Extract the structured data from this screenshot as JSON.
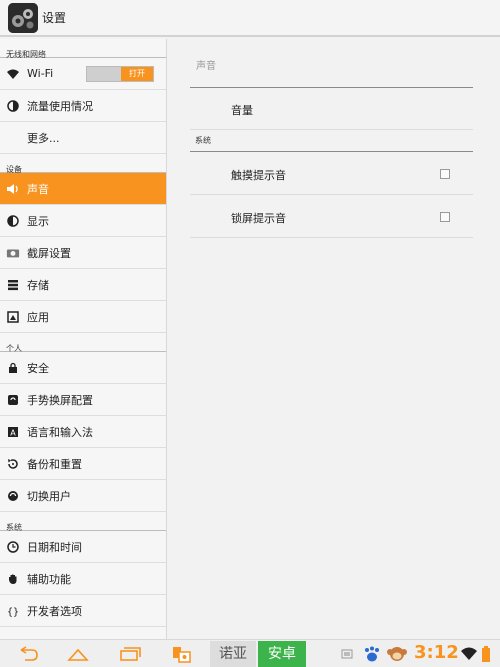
{
  "app": {
    "title": "设置",
    "icon": "settings-app-icon"
  },
  "sidebar": {
    "sections": [
      {
        "header": "无线和网络",
        "items": [
          {
            "label": "Wi-Fi",
            "icon": "wifi-icon",
            "toggle": "打开"
          },
          {
            "label": "流量使用情况",
            "icon": "data-usage-icon"
          },
          {
            "label": "更多...",
            "icon": ""
          }
        ]
      },
      {
        "header": "设备",
        "items": [
          {
            "label": "声音",
            "icon": "speaker-icon",
            "active": true
          },
          {
            "label": "显示",
            "icon": "brightness-icon"
          },
          {
            "label": "截屏设置",
            "icon": "camera-icon"
          },
          {
            "label": "存储",
            "icon": "storage-icon"
          },
          {
            "label": "应用",
            "icon": "apps-icon"
          }
        ]
      },
      {
        "header": "个人",
        "items": [
          {
            "label": "安全",
            "icon": "lock-icon"
          },
          {
            "label": "手势换屏配置",
            "icon": "rotate-icon"
          },
          {
            "label": "语言和输入法",
            "icon": "keyboard-icon"
          },
          {
            "label": "备份和重置",
            "icon": "restore-icon"
          },
          {
            "label": "切换用户",
            "icon": "switch-user-icon"
          }
        ]
      },
      {
        "header": "系统",
        "items": [
          {
            "label": "日期和时间",
            "icon": "clock-icon"
          },
          {
            "label": "辅助功能",
            "icon": "hand-icon"
          },
          {
            "label": "开发者选项",
            "icon": "braces-icon"
          }
        ]
      }
    ]
  },
  "content": {
    "title": "声音",
    "volume_label": "音量",
    "system_header": "系统",
    "touch_sound_label": "触摸提示音",
    "lock_sound_label": "锁屏提示音"
  },
  "navbar": {
    "back_icon": "back-icon",
    "home_icon": "home-icon",
    "recents_icon": "recents-icon",
    "screenshot_icon": "screenshot-icon",
    "brand_a": "诺亚",
    "brand_b": "安卓",
    "time": "3:12",
    "status_icons": [
      "notification-icon",
      "baidu-icon",
      "monkey-icon",
      "wifi-signal-icon",
      "battery-icon"
    ]
  },
  "colors": {
    "accent": "#f7931e",
    "green": "#3cb44b"
  }
}
